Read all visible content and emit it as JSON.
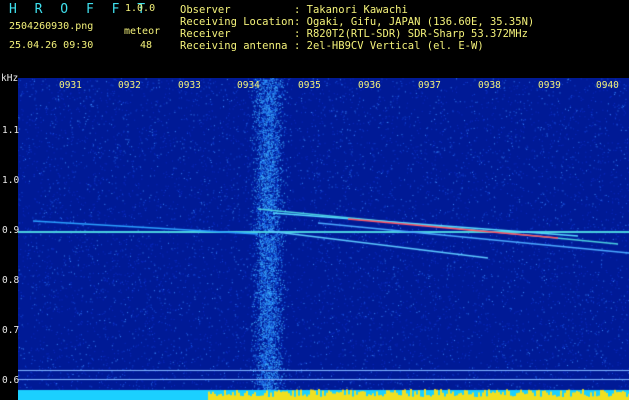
{
  "header": {
    "app_name": "H R O F F T",
    "version": "1.0.0",
    "filename": "2504260930.png",
    "datetime": "25.04.26 09:30",
    "meteor_label": "meteor",
    "meteor_count": "48"
  },
  "info": [
    {
      "label": "Observer",
      "value": ": Takanori Kawachi"
    },
    {
      "label": "Receiving Location",
      "value": ": Ogaki, Gifu, JAPAN (136.60E, 35.35N)"
    },
    {
      "label": "Receiver",
      "value": ": R820T2(RTL-SDR) SDR-Sharp 53.372MHz"
    },
    {
      "label": "Receiving antenna",
      "value": ": 2el-HB9CV Vertical (el. E-W)"
    }
  ],
  "axes": {
    "y_unit": "kHz",
    "y_ticks": [
      "1.1",
      "1.0",
      "0.9",
      "0.8",
      "0.7",
      "0.6"
    ],
    "x_ticks": [
      "0931",
      "0932",
      "0933",
      "0934",
      "0935",
      "0936",
      "0937",
      "0938",
      "0939",
      "0940"
    ]
  },
  "colors": {
    "background": "#001a96",
    "noise_band": "#3fb0ff",
    "carrier": "#4ad0e0",
    "trail": "#ff5060",
    "header_cyan": "#4fe3f0",
    "header_yellow": "#f4f27a",
    "signal_yellow": "#f0e020"
  }
}
